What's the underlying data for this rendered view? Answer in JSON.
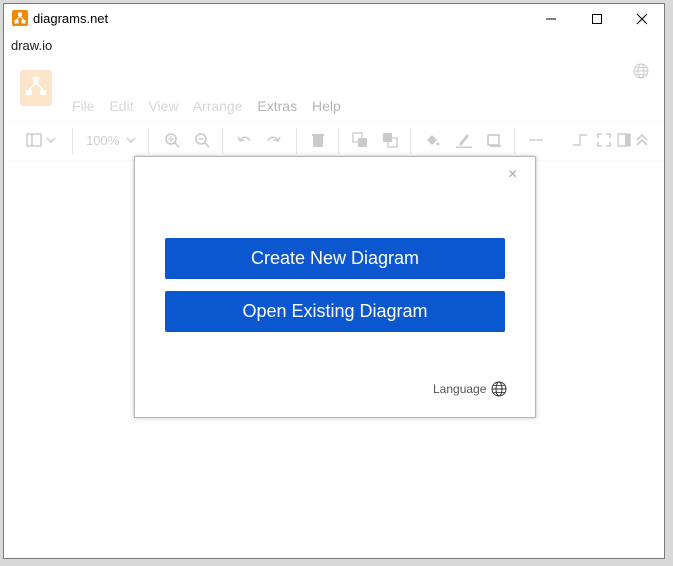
{
  "window": {
    "title": "diagrams.net",
    "subtitle": "draw.io",
    "controls": [
      "minimize",
      "maximize",
      "close"
    ]
  },
  "menu": {
    "items": [
      {
        "label": "File",
        "enabled": false
      },
      {
        "label": "Edit",
        "enabled": false
      },
      {
        "label": "View",
        "enabled": false
      },
      {
        "label": "Arrange",
        "enabled": false
      },
      {
        "label": "Extras",
        "enabled": true
      },
      {
        "label": "Help",
        "enabled": true
      }
    ]
  },
  "toolbar": {
    "zoom": "100%"
  },
  "dialog": {
    "close": "×",
    "create_label": "Create New Diagram",
    "open_label": "Open Existing Diagram",
    "language_label": "Language"
  },
  "colors": {
    "primary_button": "#0b57d0",
    "logo_orange": "#f08705"
  }
}
